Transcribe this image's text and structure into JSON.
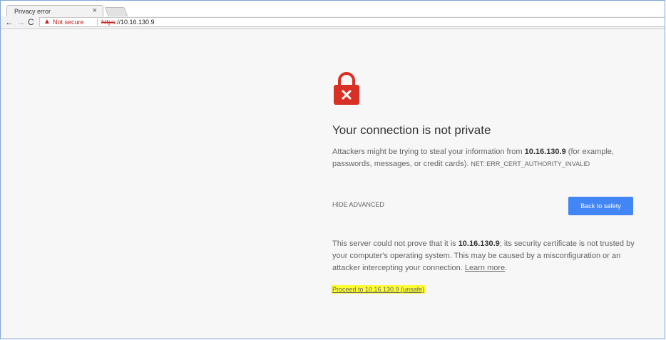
{
  "tab": {
    "title": "Privacy error",
    "close": "×"
  },
  "toolbar": {
    "back": "←",
    "forward": "→",
    "reload": "C",
    "warning_icon": "▲",
    "security_label": "Not secure",
    "url_scheme": "https",
    "url_rest": "://10.16.130.9"
  },
  "page": {
    "heading": "Your connection is not private",
    "desc_part1": "Attackers might be trying to steal your information from ",
    "host": "10.16.130.9",
    "desc_part2": " (for example, passwords, messages, or credit cards). ",
    "error_code": "NET::ERR_CERT_AUTHORITY_INVALID",
    "hide_advanced": "HIDE ADVANCED",
    "back_button": "Back to safety",
    "detail_part1": "This server could not prove that it is ",
    "detail_host": "10.16.130.9",
    "detail_part2": "; its security certificate is not trusted by your computer's operating system. This may be caused by a misconfiguration or an attacker intercepting your connection. ",
    "learn_more": "Learn more",
    "detail_end": ".",
    "proceed_link": "Proceed to 10.16.130.9 (unsafe)"
  },
  "colors": {
    "lock_red": "#d93025",
    "button_blue": "#4285f4",
    "highlight": "#ffff33"
  }
}
